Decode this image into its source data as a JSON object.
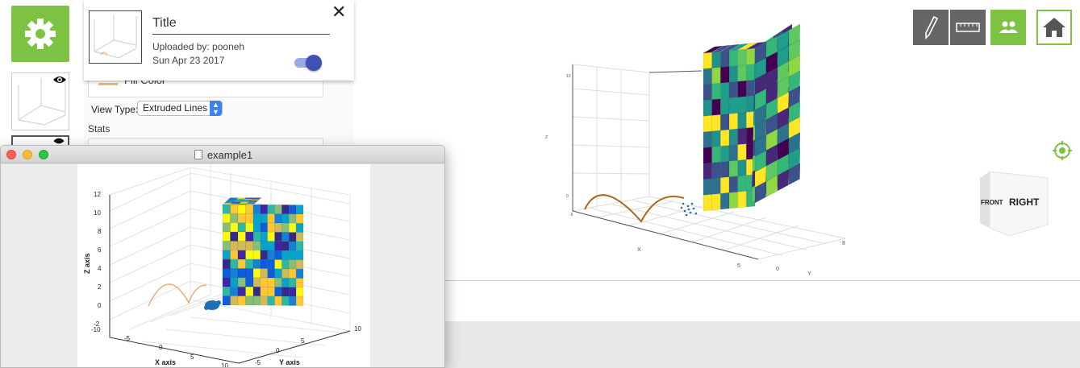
{
  "header": {
    "title": "Title",
    "uploaded": "Uploaded by: pooneh",
    "date": "Sun Apr 23 2017",
    "close_glyph": "✕",
    "toggle_on": true
  },
  "panel": {
    "peek_text": "Fill Color",
    "view_type_label": "View Type:",
    "view_type_value": "Extruded Lines",
    "stats_label": "Stats"
  },
  "toolbar": {
    "icons": [
      "pen-icon",
      "ruler-icon",
      "users-icon",
      "home-icon"
    ],
    "accent": "#7dc242",
    "dark": "#666666"
  },
  "nav_cube": {
    "front": "FRONT",
    "right": "RIGHT"
  },
  "viewer_axes": {
    "x_label": "X",
    "y_label": "Y",
    "z_label": "Z",
    "ticks": [
      "10",
      "0",
      "-5",
      "5",
      "0",
      "8"
    ]
  },
  "mac_window": {
    "title": "example1",
    "file_icon": "document-icon"
  },
  "chart_data": {
    "type": "3d",
    "xlabel": "X axis",
    "ylabel": "Y axis",
    "zlabel": "Z axis",
    "x_ticks": [
      "-10",
      "-5",
      "0",
      "5",
      "10"
    ],
    "y_ticks": [
      "-5",
      "0",
      "5",
      "10"
    ],
    "z_ticks": [
      "-2",
      "0",
      "2",
      "4",
      "6",
      "8",
      "10",
      "12"
    ],
    "xlim": [
      -10,
      10
    ],
    "ylim": [
      -5,
      10
    ],
    "zlim": [
      -2,
      12
    ]
  }
}
